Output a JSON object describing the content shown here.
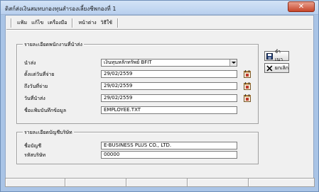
{
  "window": {
    "title": "ดิสก์ส่งเงินสมทบกองทุนสำรองเลี้ยงชีพกองที่ 1",
    "close_glyph": "✕"
  },
  "menu": [
    {
      "label": "แฟ้ม"
    },
    {
      "label": "แก้ไข"
    },
    {
      "label": "เครื่องมือ"
    },
    {
      "label": "หน้าต่าง"
    },
    {
      "label": "วิธีใช้"
    }
  ],
  "employee_section": {
    "legend": "รายละเอียดพนักงานที่นำส่ง",
    "fields": {
      "deliver": {
        "label": "นำส่ง",
        "value": "เงินทุนหลักทรัพย์ BFIT"
      },
      "start_date": {
        "label": "ตั้งแต่วันที่จ่าย",
        "value": "29/02/2559"
      },
      "end_date": {
        "label": "ถึงวันที่จ่าย",
        "value": "29/02/2559"
      },
      "submit_date": {
        "label": "วันที่นำส่ง",
        "value": "29/02/2559"
      },
      "file_name": {
        "label": "ชื่อแฟ้มบันทึกข้อมูล",
        "value": "EMPLOYEE.TXT"
      }
    }
  },
  "account_section": {
    "legend": "รายละเอียดบัญชีบริษัท",
    "fields": {
      "account_name": {
        "label": "ชื่อบัญชี",
        "value": "E-BUSINESS PLUS CO., LTD."
      },
      "company_code": {
        "label": "รหัสบริษัท",
        "value": "00000"
      }
    }
  },
  "buttons": {
    "save": "จำเนา",
    "cancel": "ยกเลิก"
  },
  "icons": {
    "save": "floppy-disk-icon",
    "cancel": "x-icon",
    "calendar": "calendar-icon"
  },
  "colors": {
    "title_bar": "#b8cfee",
    "close_button": "#c6452a",
    "client": "#f0f0f0"
  }
}
